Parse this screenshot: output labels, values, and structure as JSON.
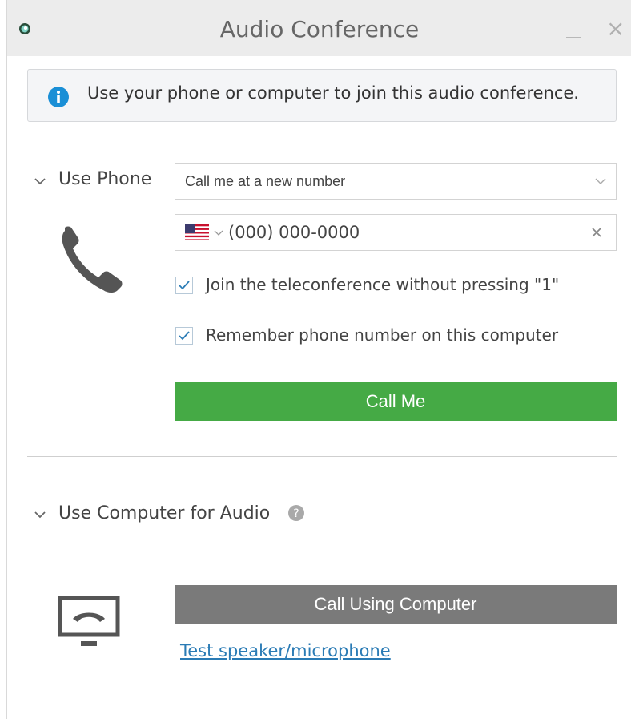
{
  "window": {
    "title": "Audio Conference",
    "close_glyph": "×"
  },
  "info": {
    "text": "Use your phone or computer to join this audio conference."
  },
  "phone_section": {
    "label": "Use Phone",
    "call_option": "Call me at a new number",
    "country": "US",
    "phone_placeholder": "(000) 000-0000",
    "checkbox_join": {
      "label": "Join the teleconference without pressing \"1\"",
      "checked": true
    },
    "checkbox_remember": {
      "label": "Remember phone number on this computer",
      "checked": true
    },
    "call_button": "Call Me"
  },
  "computer_section": {
    "label": "Use Computer for Audio",
    "call_button": "Call Using Computer",
    "test_link": "Test speaker/microphone"
  },
  "colors": {
    "accent_green": "#45aa45",
    "button_gray": "#7a7a7a",
    "link_blue": "#2a7bb5",
    "info_blue": "#1a8fd6"
  },
  "icons": [
    "app-logo-icon",
    "minimize-icon",
    "close-icon",
    "info-icon",
    "chevron-down-icon",
    "phone-handset-icon",
    "us-flag-icon",
    "clear-icon",
    "checkmark-icon",
    "help-icon",
    "computer-audio-icon"
  ]
}
